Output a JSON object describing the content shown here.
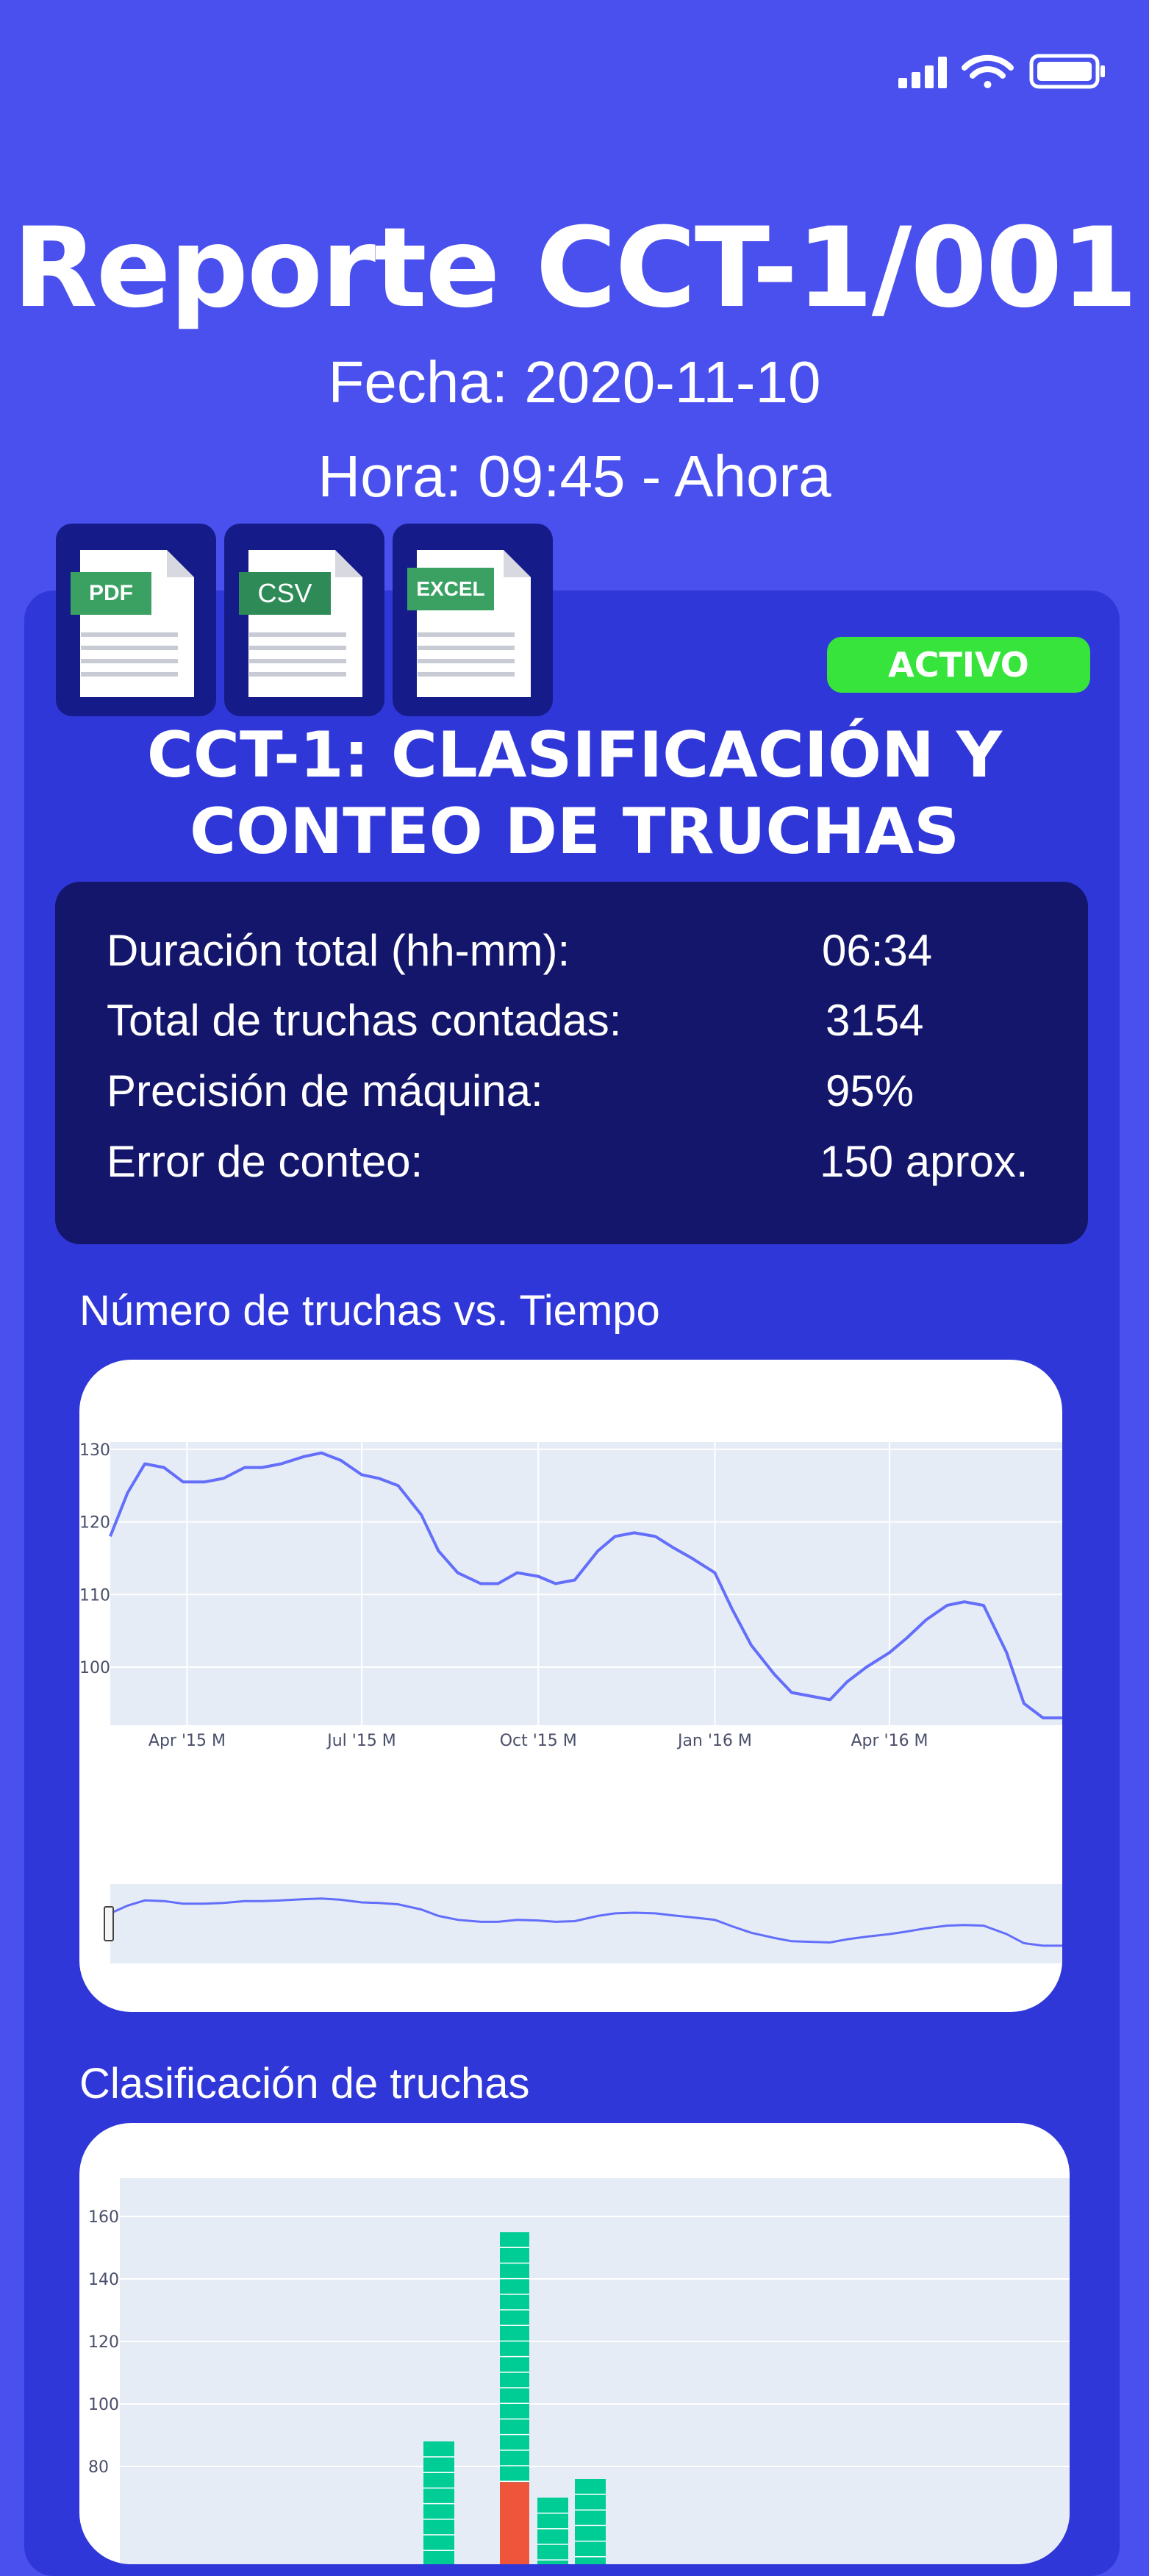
{
  "header": {
    "title": "Reporte CCT-1/001",
    "date_line": "Fecha: 2020-11-10",
    "time_line": "Hora: 09:45 - Ahora"
  },
  "exports": [
    {
      "label": "PDF",
      "icon": "pdf-file-icon",
      "tag_color": "#3aa163"
    },
    {
      "label": "CSV",
      "icon": "csv-file-icon",
      "tag_color": "#2e8b57"
    },
    {
      "label": "EXCEL",
      "icon": "excel-file-icon",
      "tag_color": "#3aa163"
    }
  ],
  "status_badge": {
    "label": "ACTIVO",
    "color": "#37e43c"
  },
  "machine_title": {
    "line1": "CCT-1: CLASIFICACIÓN Y",
    "line2": "CONTEO DE TRUCHAS"
  },
  "summary": [
    {
      "label": "Duración total (hh-mm):",
      "value": "06:34"
    },
    {
      "label": "Total de truchas contadas:",
      "value": "3154"
    },
    {
      "label": "Precisión de máquina:",
      "value": "95%"
    },
    {
      "label": "Error de conteo:",
      "value": "150 aprox."
    }
  ],
  "line_section_title": "Número de truchas vs. Tiempo",
  "bar_section_title": "Clasificación de truchas",
  "colors": {
    "background": "#4a50ee",
    "panel": "#3037d8",
    "card": "#13166a",
    "line": "#636efa",
    "bar_green": "#00cc96",
    "bar_red": "#ef553b",
    "plot_bg": "#e5ecf6"
  },
  "chart_data": [
    {
      "type": "line",
      "x_ticks": [
        "Apr '15 M",
        "Jul '15 M",
        "Oct '15 M",
        "Jan '16 M",
        "Apr '16 M"
      ],
      "y_ticks": [
        100,
        110,
        120,
        130
      ],
      "ylim": [
        92,
        131
      ],
      "xlim": [
        "2015-02-20",
        "2016-06-30"
      ],
      "range_slider": true,
      "x": [
        "2015-02-20",
        "2015-03-01",
        "2015-03-10",
        "2015-03-20",
        "2015-03-30",
        "2015-04-10",
        "2015-04-20",
        "2015-05-01",
        "2015-05-10",
        "2015-05-20",
        "2015-06-01",
        "2015-06-10",
        "2015-06-20",
        "2015-07-01",
        "2015-07-10",
        "2015-07-20",
        "2015-08-01",
        "2015-08-10",
        "2015-08-20",
        "2015-09-01",
        "2015-09-10",
        "2015-09-20",
        "2015-10-01",
        "2015-10-10",
        "2015-10-20",
        "2015-11-01",
        "2015-11-10",
        "2015-11-20",
        "2015-12-01",
        "2015-12-10",
        "2015-12-20",
        "2016-01-01",
        "2016-01-10",
        "2016-01-20",
        "2016-02-01",
        "2016-02-10",
        "2016-02-20",
        "2016-03-01",
        "2016-03-10",
        "2016-03-20",
        "2016-04-01",
        "2016-04-10",
        "2016-04-20",
        "2016-05-01",
        "2016-05-10",
        "2016-05-20",
        "2016-06-01",
        "2016-06-10",
        "2016-06-20",
        "2016-06-30"
      ],
      "values": [
        118,
        124,
        128,
        127.5,
        125.5,
        125.5,
        126,
        127.5,
        127.5,
        128,
        129,
        129.5,
        128.5,
        126.5,
        126,
        125,
        121,
        116,
        113,
        111.5,
        111.5,
        113,
        112.5,
        111.5,
        112,
        116,
        118,
        118.5,
        118,
        116.5,
        115,
        113,
        108,
        103,
        99,
        96.5,
        96,
        95.5,
        98,
        100,
        102,
        104,
        106.5,
        108.5,
        109,
        108.5,
        102,
        95,
        93,
        93
      ]
    },
    {
      "type": "bar",
      "y_ticks": [
        80,
        100,
        120,
        140,
        160
      ],
      "ylim": [
        70,
        165
      ],
      "bars": [
        {
          "x": 1,
          "green": 88,
          "red": 0
        },
        {
          "x": 2,
          "green": 155,
          "red": 75
        },
        {
          "x": 3,
          "green": 70,
          "red": 0
        },
        {
          "x": 4,
          "green": 76,
          "red": 0
        }
      ]
    }
  ]
}
